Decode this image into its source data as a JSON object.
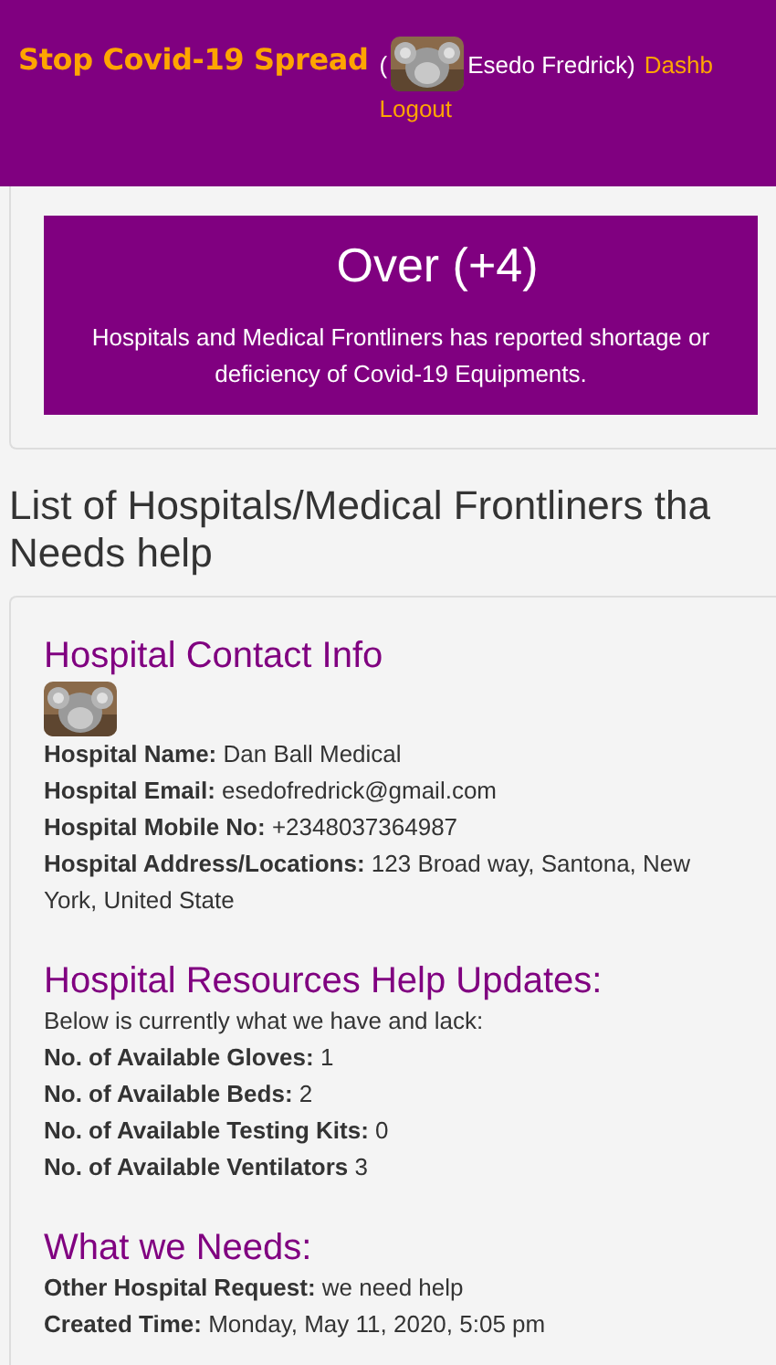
{
  "header": {
    "title": "Stop Covid-19 Spread",
    "user_open": "(",
    "user_name": "Esedo Fredrick)",
    "dashboard_link": "Dashb",
    "logout_link": "Logout"
  },
  "alert": {
    "title": "Over (+4)",
    "message": "Hospitals and Medical Frontliners has reported shortage or deficiency of Covid-19 Equipments."
  },
  "list_heading": [
    "List of Hospitals/Medical Frontliners tha",
    "Needs help"
  ],
  "hospital": {
    "contact": {
      "heading": "Hospital Contact Info",
      "rows": [
        "**Hospital Name:** Dan Ball Medical",
        "**Hospital Email:** esedofredrick@gmail.com",
        "**Hospital Mobile No:** +2348037364987",
        "**Hospital Address/Locations:** 123 Broad way, Santona, New York, United State"
      ]
    },
    "resources": {
      "heading": "Hospital Resources Help Updates:",
      "intro": "Below is currently what we have and lack:",
      "rows": [
        "**No. of Available Gloves:** 1",
        "**No. of Available Beds:** 2",
        "**No. of Available Testing Kits:** 0",
        "**No. of Available Ventilators** 3"
      ]
    },
    "needs": {
      "heading": "What we Needs:",
      "rows": [
        "**Other Hospital Request:** we need help",
        "**Created Time:** Monday, May 11, 2020, 5:05 pm"
      ]
    }
  }
}
